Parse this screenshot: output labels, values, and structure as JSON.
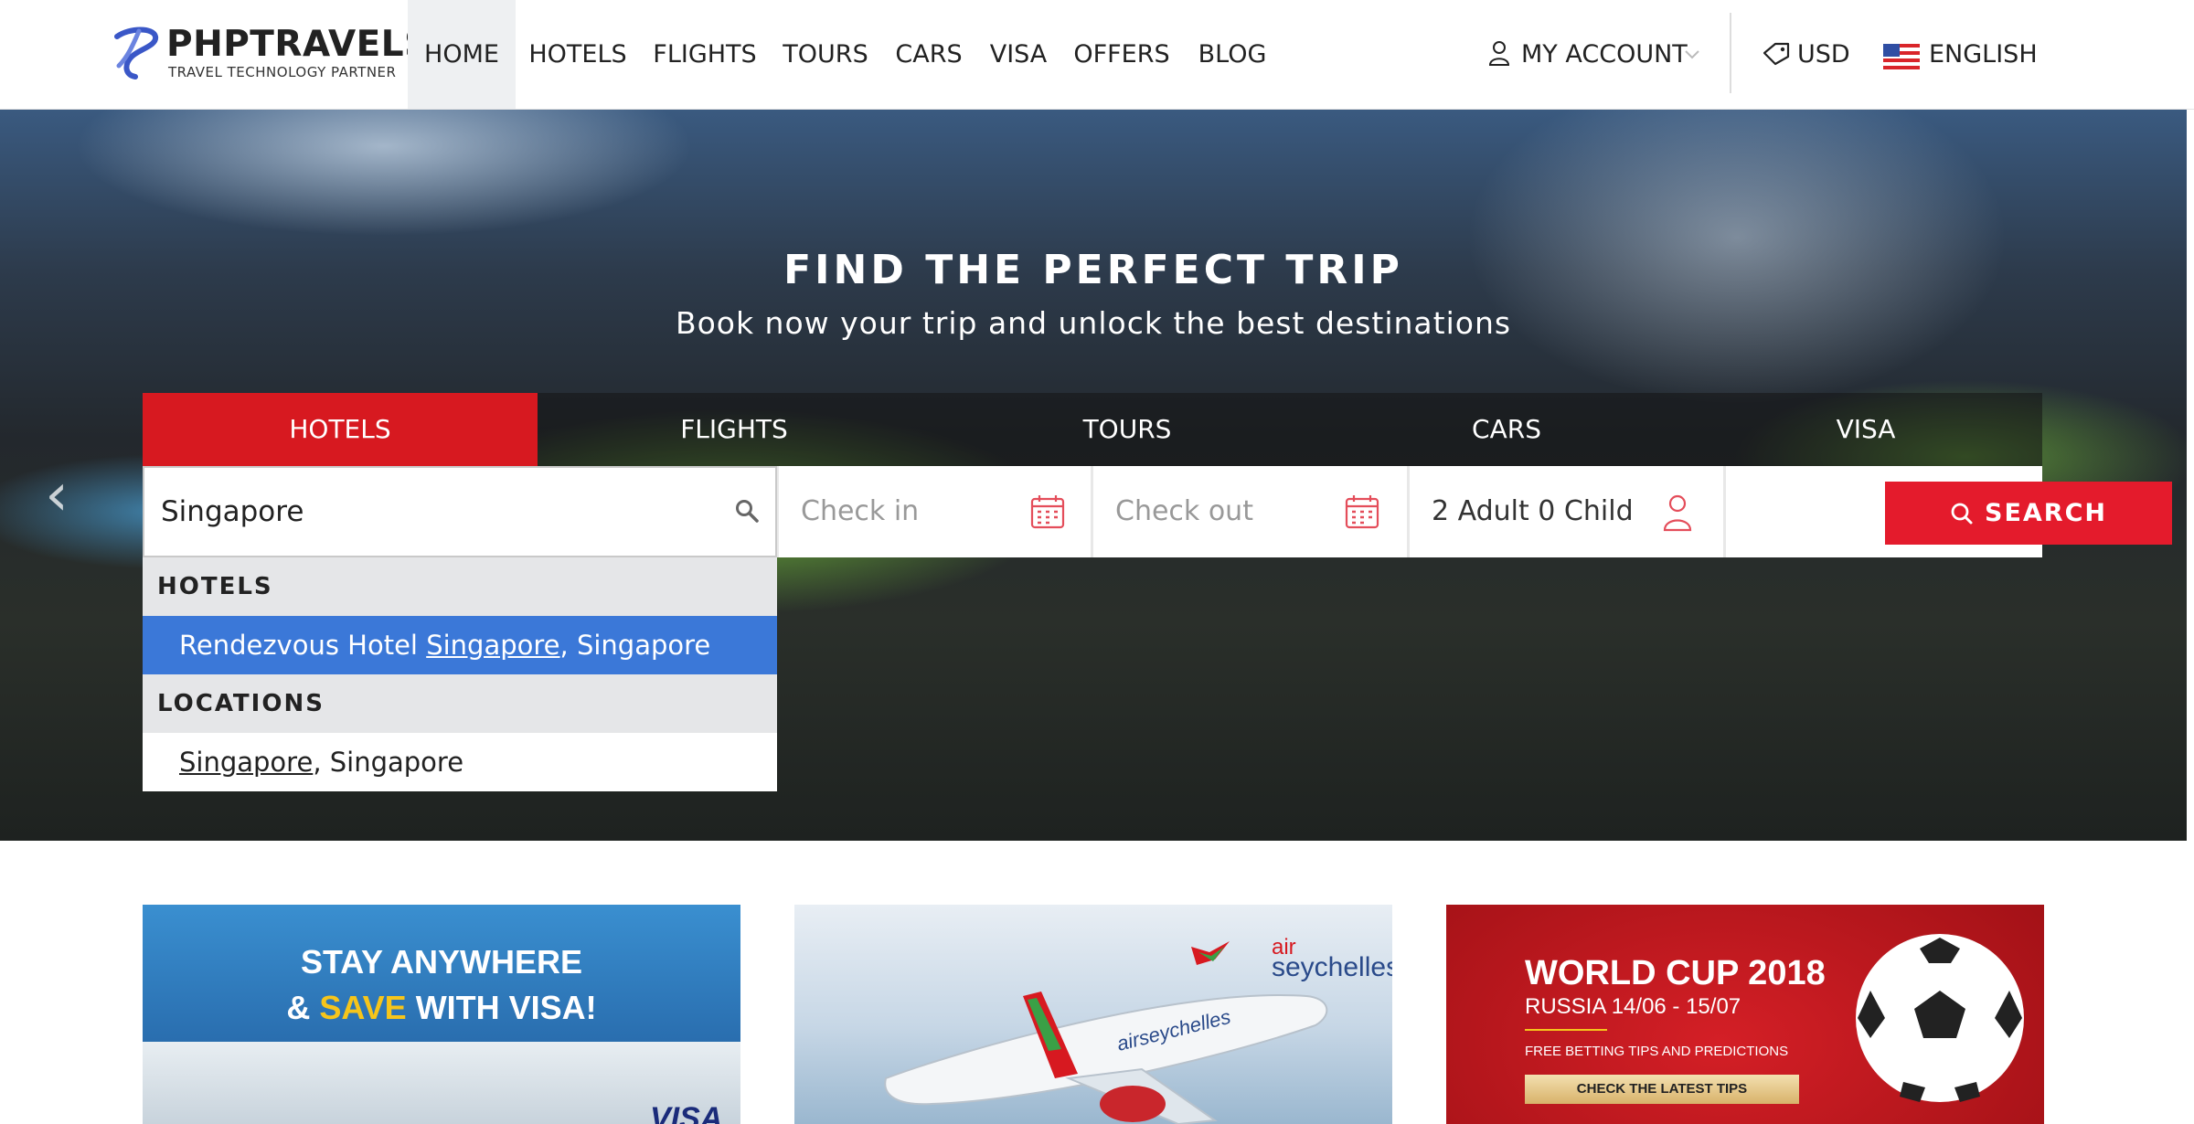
{
  "brand": {
    "name": "PHPTRAVELS",
    "tagline": "TRAVEL TECHNOLOGY PARTNER"
  },
  "nav": [
    {
      "label": "HOME",
      "active": true
    },
    {
      "label": "HOTELS"
    },
    {
      "label": "FLIGHTS"
    },
    {
      "label": "TOURS"
    },
    {
      "label": "CARS"
    },
    {
      "label": "VISA"
    },
    {
      "label": "OFFERS"
    },
    {
      "label": "BLOG"
    }
  ],
  "header_right": {
    "account": "MY ACCOUNT",
    "currency": "USD",
    "language": "ENGLISH"
  },
  "hero": {
    "title": "FIND THE PERFECT TRIP",
    "subtitle": "Book now your trip and unlock the best destinations"
  },
  "tabs": [
    {
      "label": "HOTELS",
      "active": true
    },
    {
      "label": "FLIGHTS"
    },
    {
      "label": "TOURS"
    },
    {
      "label": "CARS"
    },
    {
      "label": "VISA"
    }
  ],
  "search": {
    "destination_value": "Singapore",
    "checkin_placeholder": "Check in",
    "checkout_placeholder": "Check out",
    "guests": "2 Adult 0 Child",
    "button": "SEARCH"
  },
  "autocomplete": {
    "hotels_header": "HOTELS",
    "hotel_result": {
      "prefix": "Rendezvous Hotel ",
      "match": "Singapore",
      "suffix": ", Singapore"
    },
    "locations_header": "LOCATIONS",
    "location_result": {
      "prefix": "",
      "match": "Singapore",
      "suffix": ", Singapore"
    }
  },
  "promos": {
    "visa": {
      "line1": "STAY ANYWHERE",
      "line2_a": "& ",
      "line2_b": "SAVE",
      "line2_c": " WITH VISA!",
      "brand": "VISA"
    },
    "airline": {
      "logo_line1": "air",
      "logo_line2": "seychelles",
      "plane_text": "airseychelles"
    },
    "worldcup": {
      "title": "WORLD CUP 2018",
      "dates": "RUSSIA 14/06 - 15/07",
      "tips": "FREE BETTING TIPS AND PREDICTIONS",
      "cta": "CHECK THE LATEST TIPS"
    }
  },
  "colors": {
    "accent_red": "#d71920",
    "search_red": "#e41b2c",
    "selected_blue": "#3b78d8",
    "visa_yellow": "#f6c51b"
  }
}
